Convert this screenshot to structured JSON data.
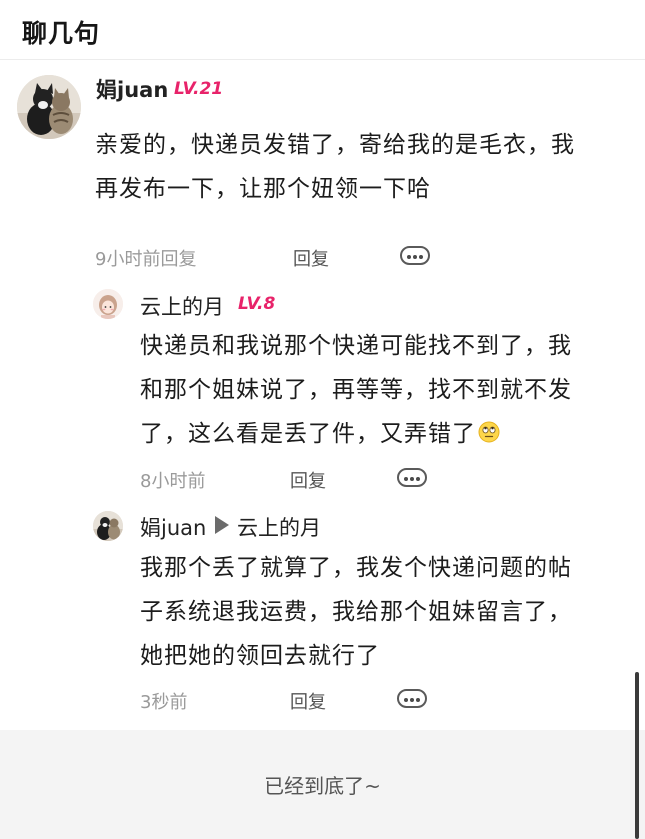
{
  "header": {
    "title": "聊几句"
  },
  "comments": [
    {
      "username": "娟juan",
      "level": "LV.21",
      "text_lines": [
        "亲爱的，快递员发错了，寄给我的是毛衣，我",
        "再发布一下，让那个妞领一下哈"
      ],
      "time": "9小时前回复",
      "reply_label": "回复"
    },
    {
      "username": "云上的月",
      "level": "LV.8",
      "text_lines": [
        "快递员和我说那个快递可能找不到了，我",
        "和那个姐妹说了，再等等，找不到就不发",
        "了，这么看是丢了件，又弄错了"
      ],
      "emoji": "eye-roll-emoji",
      "time": "8小时前",
      "reply_label": "回复"
    },
    {
      "username": "娟juan",
      "reply_to": "云上的月",
      "text_lines": [
        "我那个丢了就算了，我发个快递问题的帖",
        "子系统退我运费，我给那个姐妹留言了，",
        "她把她的领回去就行了"
      ],
      "time": "3秒前",
      "reply_label": "回复"
    }
  ],
  "footer": {
    "text": "已经到底了~"
  },
  "icons": [
    "more-options-icon",
    "reply-arrow-icon"
  ]
}
